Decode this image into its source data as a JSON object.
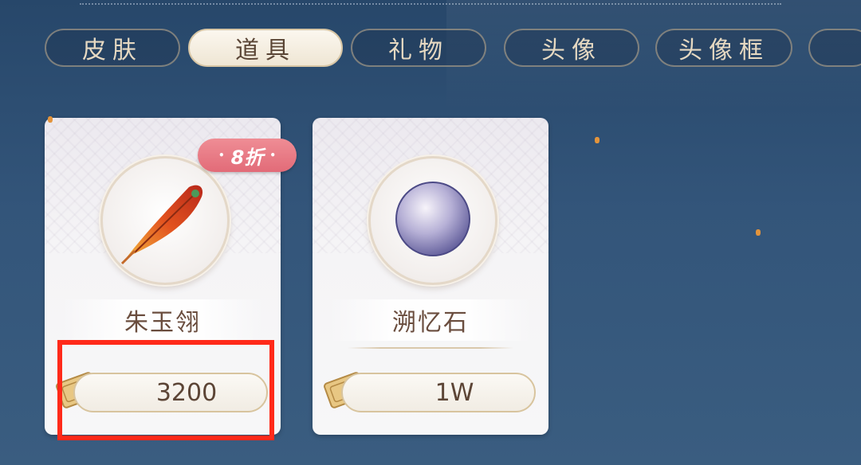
{
  "tabs": [
    {
      "label": "皮肤",
      "active": false
    },
    {
      "label": "道具",
      "active": true
    },
    {
      "label": "礼物",
      "active": false
    },
    {
      "label": "头像",
      "active": false
    },
    {
      "label": "头像框",
      "active": false
    }
  ],
  "items": [
    {
      "name": "朱玉翎",
      "price": "3200",
      "discount": "8折",
      "icon": "red-feather-icon"
    },
    {
      "name": "溯忆石",
      "price": "1W",
      "icon": "pearl-stone-icon"
    }
  ],
  "currency_icon": "ticket-coupon-icon",
  "colors": {
    "background": "#2e4f74",
    "tab_active": "#f3ece0",
    "discount_badge": "#e87a85",
    "highlight": "#ff2a1a",
    "price_border": "#d8c49e"
  }
}
